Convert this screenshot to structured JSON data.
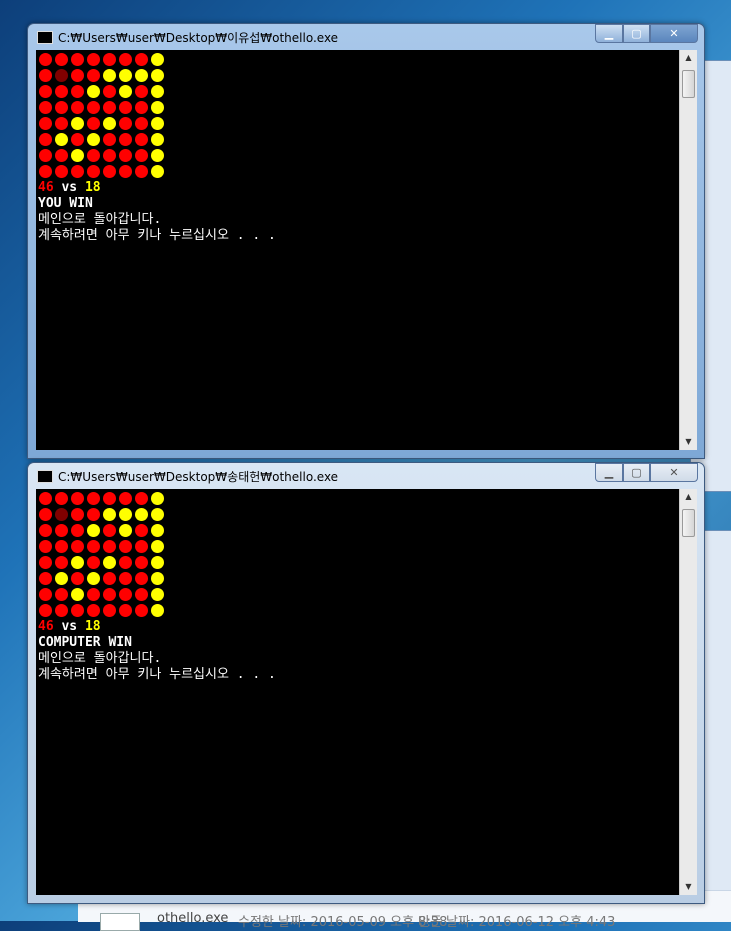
{
  "windows": [
    {
      "title": "C:₩Users₩user₩Desktop₩이유섭₩othello.exe",
      "board": [
        "RRRRRRRY",
        "RDRRYYYY",
        "RRRYRYRY",
        "RRRRRRRY",
        "RRYRYRRY",
        "RYRYRRRY",
        "RRYRRRRY",
        "RRRRRRRY"
      ],
      "score_player": "46",
      "score_vs": "vs",
      "score_computer": "18",
      "result": "YOU WIN",
      "line_main": "메인으로 돌아갑니다.",
      "line_continue": "계속하려면 아무 키나 누르십시오 . . ."
    },
    {
      "title": "C:₩Users₩user₩Desktop₩송태헌₩othello.exe",
      "board": [
        "RRRRRRRY",
        "RDRRYYYY",
        "RRRYRYRY",
        "RRRRRRRY",
        "RRYRYRRY",
        "RYRYRRRY",
        "RRYRRRRY",
        "RRRRRRRY"
      ],
      "score_player": "46",
      "score_vs": "vs",
      "score_computer": "18",
      "result": "COMPUTER WIN",
      "line_main": "메인으로 돌아갑니다.",
      "line_continue": "계속하려면 아무 키나 누르십시오 . . ."
    }
  ],
  "explorer": {
    "file_name": "othello.exe",
    "modified": "수정한 날짜: 2016-05-09 오후 8:38",
    "created": "만든 날짜: 2016-06-12 오후 4:43"
  },
  "colors": {
    "player": "#ff0000",
    "computer": "#ffff00",
    "console_bg": "#000000"
  }
}
